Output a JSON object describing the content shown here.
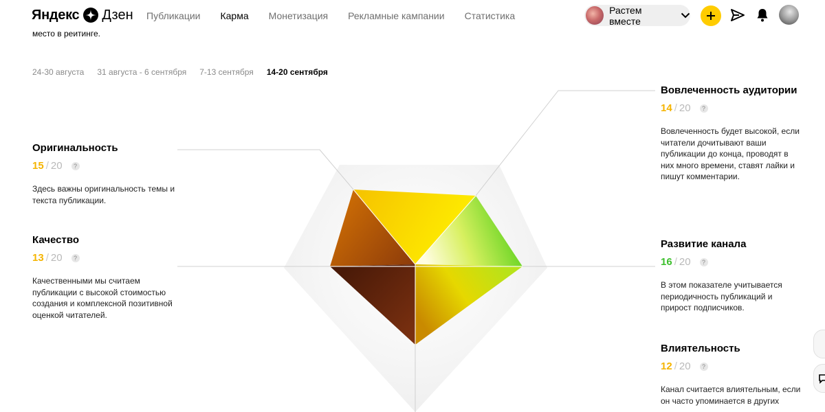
{
  "header": {
    "logo_left": "Яндекс",
    "logo_right": "Дзен",
    "nav": [
      "Публикации",
      "Карма",
      "Монетизация",
      "Рекламные кампании",
      "Статистика"
    ],
    "active_nav": "Карма",
    "channel_name": "Растем вместе",
    "icons": [
      "plus-icon",
      "send-icon",
      "bell-icon",
      "user-avatar"
    ]
  },
  "intro_fragment": "место в рейтинге.",
  "weeks": [
    "24-30 августа",
    "31 августа - 6 сентября",
    "7-13 сентября",
    "14-20 сентября"
  ],
  "active_week": "14-20 сентября",
  "metrics": {
    "originality": {
      "title": "Оригинальность",
      "value": "15",
      "max": "20",
      "color": "#f5b400",
      "desc": "Здесь важны оригинальность темы и текста публикации."
    },
    "quality": {
      "title": "Качество",
      "value": "13",
      "max": "20",
      "color": "#f5b400",
      "desc": "Качественными мы считаем публикации с высокой стоимостью создания и комплексной позитивной оценкой читателей."
    },
    "engagement": {
      "title": "Вовлеченность аудитории",
      "value": "14",
      "max": "20",
      "color": "#f5b400",
      "desc": "Вовлеченность будет высокой, если читатели дочитывают ваши публикации до конца, проводят в них много времени, ставят лайки и пишут комментарии."
    },
    "growth": {
      "title": "Развитие канала",
      "value": "16",
      "max": "20",
      "color": "#3cbf2c",
      "desc": "В этом показателе учитывается периодичность публикаций и прирост подписчиков."
    },
    "influence": {
      "title": "Влиятельность",
      "value": "12",
      "max": "20",
      "color": "#f5b400",
      "desc": "Канал считается влиятельным, если он часто упоминается в других"
    }
  },
  "separator": "/",
  "help_glyph": "?"
}
